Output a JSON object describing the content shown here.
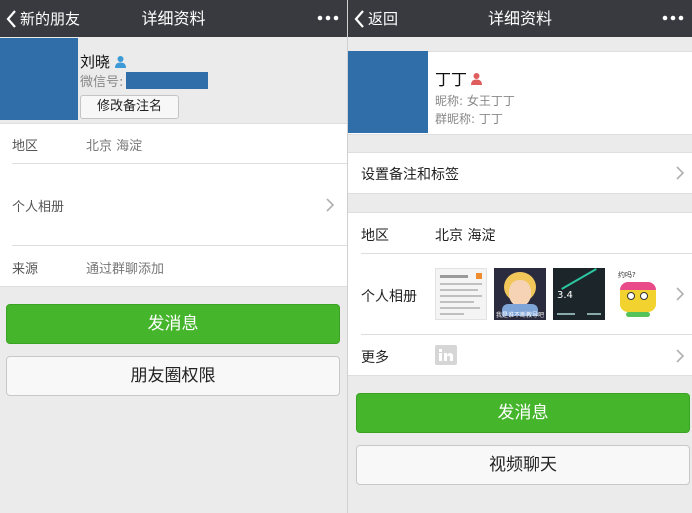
{
  "left": {
    "nav": {
      "back": "新的朋友",
      "title": "详细资料"
    },
    "profile": {
      "name": "刘晓",
      "wechat_label": "微信号:",
      "edit_button": "修改备注名"
    },
    "rows": [
      {
        "label": "地区",
        "value": "北京 海淀"
      },
      {
        "label": "个人相册"
      },
      {
        "label": "来源",
        "value": "通过群聊添加"
      }
    ],
    "buttons": {
      "message": "发消息",
      "moments": "朋友圈权限"
    }
  },
  "right": {
    "nav": {
      "back": "返回",
      "title": "详细资料"
    },
    "profile": {
      "name": "丁丁",
      "nickname": "昵称: 女王丁丁",
      "group_nickname": "群昵称: 丁丁"
    },
    "rows": [
      {
        "label": "设置备注和标签"
      },
      {
        "label": "地区",
        "value": "北京 海淀"
      },
      {
        "label": "个人相册"
      },
      {
        "label": "更多"
      }
    ],
    "album_captions": {
      "photo2": "我是谁不断教导吧",
      "photo3": "3.4",
      "photo4": "约吗?"
    },
    "buttons": {
      "message": "发消息",
      "video": "视频聊天"
    }
  },
  "icons": {
    "back": "chevron-left-icon",
    "more": "more-dots-icon",
    "gender_male": "male-user-icon",
    "gender_female": "female-user-icon",
    "chevron": "chevron-right-icon",
    "linkedin": "linkedin-icon"
  },
  "colors": {
    "navbar": "#393a3f",
    "primary_green": "#45b52c",
    "avatar": "#2f6ea8",
    "male_icon": "#3e9ad6",
    "female_icon": "#e05d5d"
  }
}
